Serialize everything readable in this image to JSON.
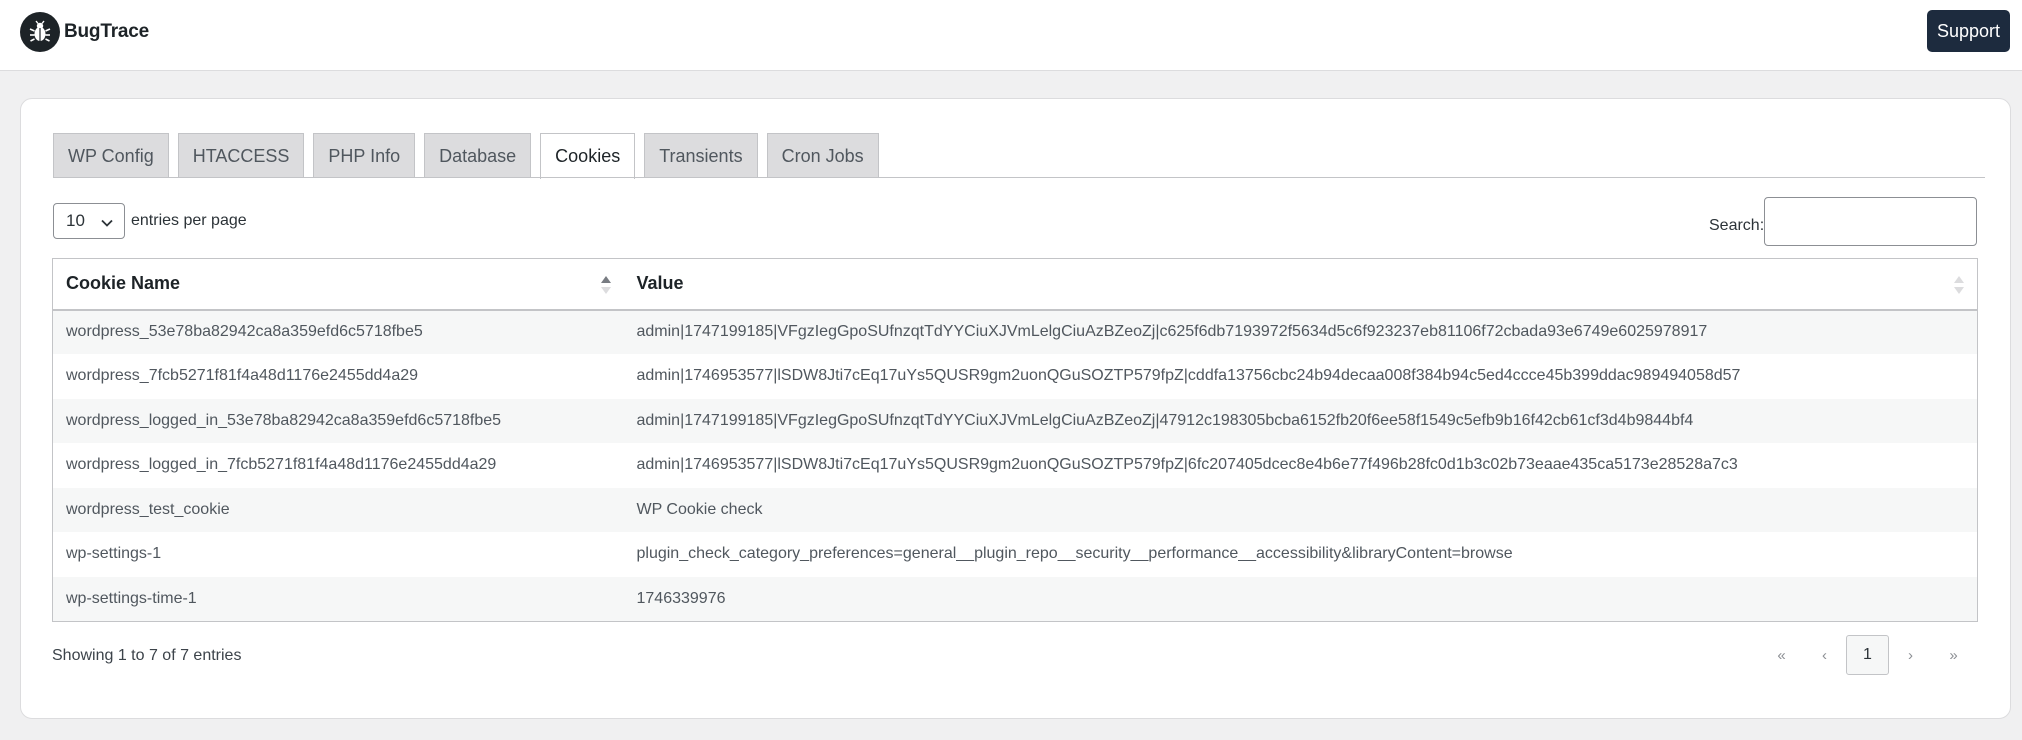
{
  "header": {
    "app_name": "BugTrace",
    "logo_icon": "bug-icon",
    "support_label": "Support"
  },
  "tabs": [
    {
      "label": "WP Config",
      "active": false
    },
    {
      "label": "HTACCESS",
      "active": false
    },
    {
      "label": "PHP Info",
      "active": false
    },
    {
      "label": "Database",
      "active": false
    },
    {
      "label": "Cookies",
      "active": true
    },
    {
      "label": "Transients",
      "active": false
    },
    {
      "label": "Cron Jobs",
      "active": false
    }
  ],
  "controls": {
    "page_length_value": "10",
    "page_length_label": "entries per page",
    "search_label": "Search:",
    "search_value": ""
  },
  "table": {
    "columns": [
      "Cookie Name",
      "Value"
    ],
    "rows": [
      [
        "wordpress_53e78ba82942ca8a359efd6c5718fbe5",
        "admin|1747199185|VFgzIegGpoSUfnzqtTdYYCiuXJVmLelgCiuAzBZeoZj|c625f6db7193972f5634d5c6f923237eb81106f72cbada93e6749e6025978917"
      ],
      [
        "wordpress_7fcb5271f81f4a48d1176e2455dd4a29",
        "admin|1746953577|lSDW8Jti7cEq17uYs5QUSR9gm2uonQGuSOZTP579fpZ|cddfa13756cbc24b94decaa008f384b94c5ed4ccce45b399ddac989494058d57"
      ],
      [
        "wordpress_logged_in_53e78ba82942ca8a359efd6c5718fbe5",
        "admin|1747199185|VFgzIegGpoSUfnzqtTdYYCiuXJVmLelgCiuAzBZeoZj|47912c198305bcba6152fb20f6ee58f1549c5efb9b16f42cb61cf3d4b9844bf4"
      ],
      [
        "wordpress_logged_in_7fcb5271f81f4a48d1176e2455dd4a29",
        "admin|1746953577|lSDW8Jti7cEq17uYs5QUSR9gm2uonQGuSOZTP579fpZ|6fc207405dcec8e4b6e77f496b28fc0d1b3c02b73eaae435ca5173e28528a7c3"
      ],
      [
        "wordpress_test_cookie",
        "WP Cookie check"
      ],
      [
        "wp-settings-1",
        "plugin_check_category_preferences=general__plugin_repo__security__performance__accessibility&libraryContent=browse"
      ],
      [
        "wp-settings-time-1",
        "1746339976"
      ]
    ]
  },
  "footer": {
    "info": "Showing 1 to 7 of 7 entries",
    "pager": {
      "first": "«",
      "prev": "‹",
      "current": "1",
      "next": "›",
      "last": "»"
    }
  },
  "colors": {
    "accent": "#1d2b3e",
    "background": "#f0f0f1",
    "stripe": "#f6f7f7"
  }
}
